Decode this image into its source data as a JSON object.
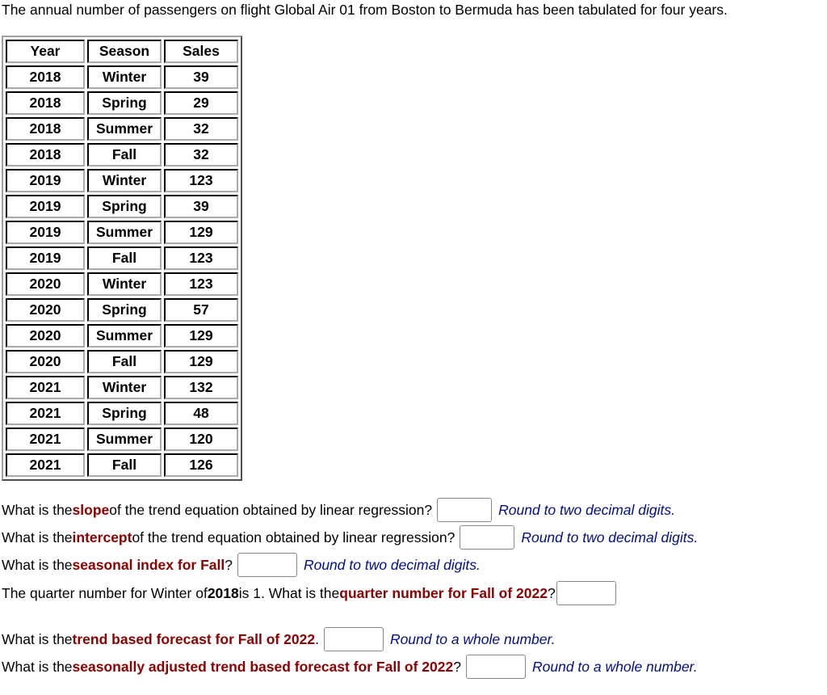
{
  "intro": "The annual number of passengers on flight Global Air 01 from Boston to Bermuda has been tabulated for four years.",
  "table": {
    "headers": [
      "Year",
      "Season",
      "Sales"
    ],
    "rows": [
      [
        "2018",
        "Winter",
        "39"
      ],
      [
        "2018",
        "Spring",
        "29"
      ],
      [
        "2018",
        "Summer",
        "32"
      ],
      [
        "2018",
        "Fall",
        "32"
      ],
      [
        "2019",
        "Winter",
        "123"
      ],
      [
        "2019",
        "Spring",
        "39"
      ],
      [
        "2019",
        "Summer",
        "129"
      ],
      [
        "2019",
        "Fall",
        "123"
      ],
      [
        "2020",
        "Winter",
        "123"
      ],
      [
        "2020",
        "Spring",
        "57"
      ],
      [
        "2020",
        "Summer",
        "129"
      ],
      [
        "2020",
        "Fall",
        "129"
      ],
      [
        "2021",
        "Winter",
        "132"
      ],
      [
        "2021",
        "Spring",
        "48"
      ],
      [
        "2021",
        "Summer",
        "120"
      ],
      [
        "2021",
        "Fall",
        "126"
      ]
    ]
  },
  "questions": {
    "slope": {
      "pre": "What is the ",
      "key": "slope",
      "post": " of the trend equation obtained by linear regression?",
      "value": "",
      "hint": "Round to two decimal digits."
    },
    "intercept": {
      "pre": "What is the ",
      "key": "intercept",
      "post": " of the trend equation obtained by linear regression?",
      "value": "",
      "hint": "Round to two decimal digits."
    },
    "seasonal_index": {
      "pre": "What is the ",
      "key": "seasonal index for Fall",
      "post": "?",
      "value": "",
      "hint": "Round to two decimal digits."
    },
    "quarter_number": {
      "pre": "The quarter number for Winter of ",
      "bold": "2018",
      "mid": " is 1. What is the ",
      "key": "quarter number for Fall of 2022",
      "post": "?",
      "value": ""
    },
    "trend_forecast": {
      "pre": "What is the ",
      "key": "trend based forecast for Fall of 2022",
      "post": ".",
      "value": "",
      "hint": "Round to a whole number."
    },
    "seasonal_forecast": {
      "pre": "What is the ",
      "key": "seasonally adjusted trend based forecast for Fall of 2022",
      "post": "?",
      "value": "",
      "hint": "Round to a whole number."
    }
  }
}
